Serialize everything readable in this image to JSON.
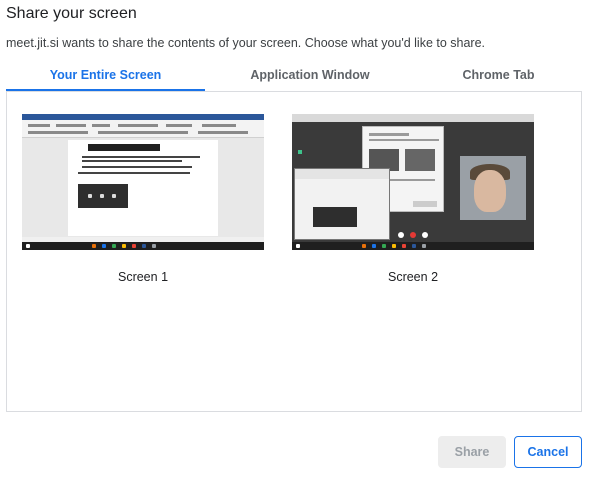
{
  "dialog": {
    "title": "Share your screen",
    "subtitle": "meet.jit.si wants to share the contents of your screen. Choose what you'd like to share."
  },
  "tabs": [
    {
      "label": "Your Entire Screen",
      "active": true
    },
    {
      "label": "Application Window",
      "active": false
    },
    {
      "label": "Chrome Tab",
      "active": false
    }
  ],
  "screens": [
    {
      "label": "Screen 1",
      "thumbnail": "word-document-desktop"
    },
    {
      "label": "Screen 2",
      "thumbnail": "jitsi-meeting-desktop"
    }
  ],
  "buttons": {
    "share_label": "Share",
    "cancel_label": "Cancel"
  },
  "colors": {
    "accent": "#1a73e8",
    "disabled_bg": "#ededed",
    "disabled_text": "#9aa0a6",
    "border": "#dadce0"
  }
}
